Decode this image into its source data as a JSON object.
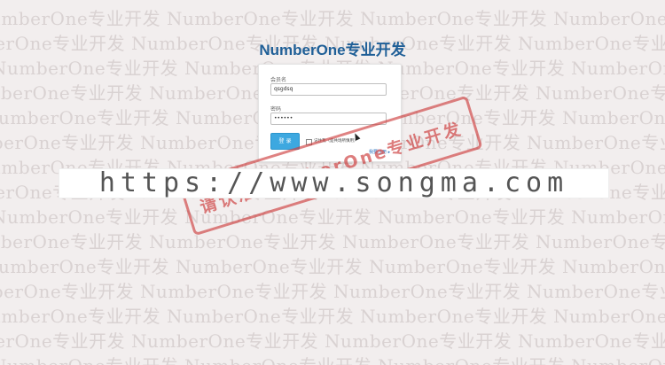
{
  "page": {
    "title": "NumberOne专业开发"
  },
  "background_watermark": {
    "text": "NumberOne专业开发 NumberOne专业开发 NumberOne专业开发 NumberOne专业开发",
    "color": "#d9d2d2"
  },
  "login": {
    "username_label": "会员名",
    "username_value": "qsgdsq",
    "password_label": "密码",
    "password_value": "••••••",
    "submit_label": "登 录",
    "remember_label": "记住我（是共场所慎用）",
    "register_link": "我要注册 ▸",
    "accent_color": "#3da8e0"
  },
  "stamp": {
    "text": "请认准NumberOne专业开发",
    "color": "#cd3c3c"
  },
  "banner": {
    "text": "https://www.songma.com"
  }
}
